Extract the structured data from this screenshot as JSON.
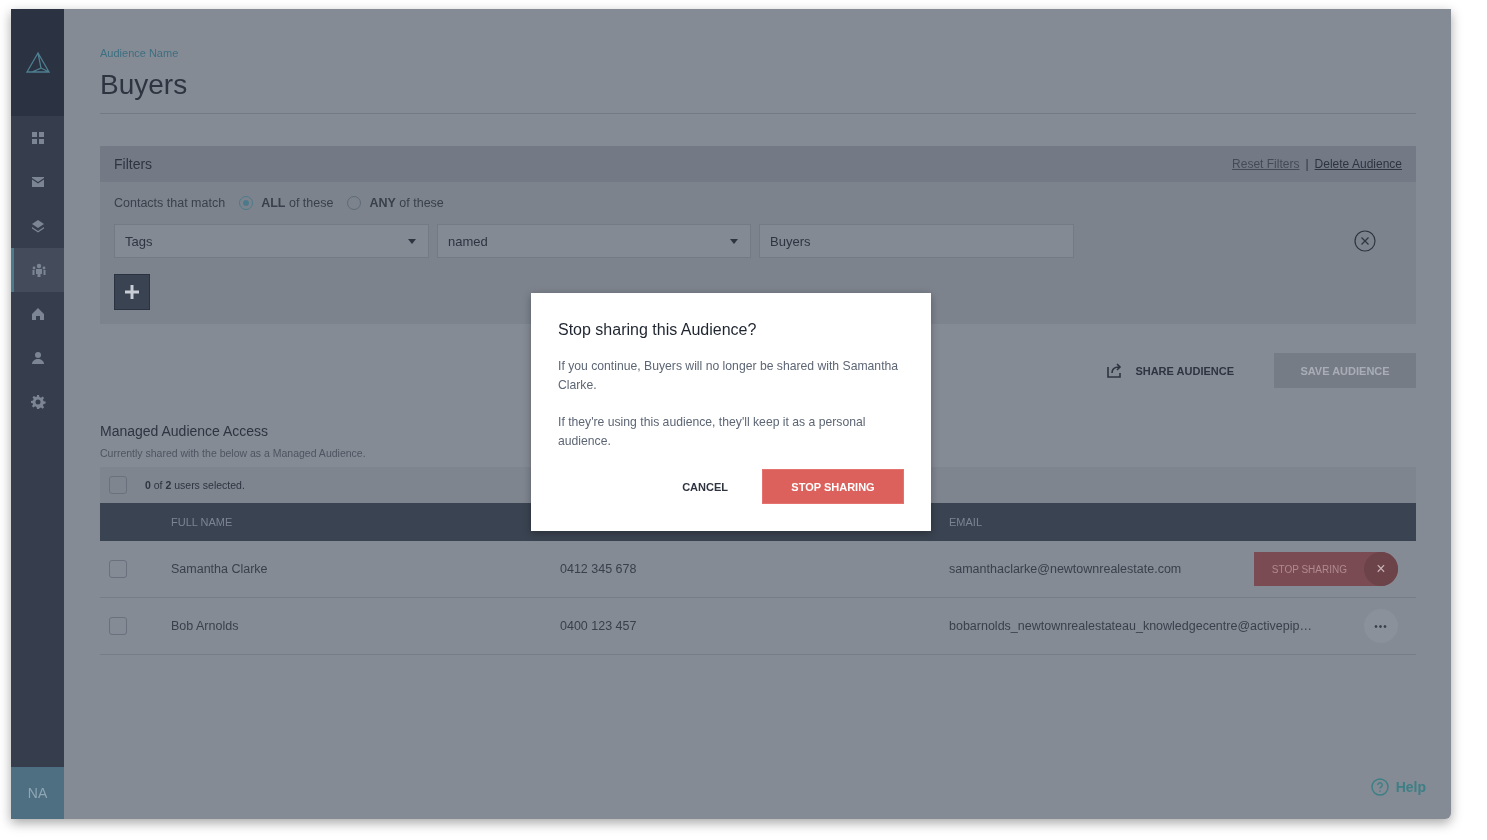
{
  "sidebar": {
    "items": [
      {
        "kind": "grid",
        "selected": false
      },
      {
        "kind": "mail",
        "selected": false
      },
      {
        "kind": "layers",
        "selected": false
      },
      {
        "kind": "people",
        "selected": true
      },
      {
        "kind": "home",
        "selected": false
      },
      {
        "kind": "person",
        "selected": false
      },
      {
        "kind": "gear",
        "selected": false
      }
    ],
    "avatar": "NA"
  },
  "header": {
    "label": "Audience Name",
    "title": "Buyers"
  },
  "filters": {
    "title": "Filters",
    "reset_link": "Reset Filters",
    "separator": "|",
    "delete_link": "Delete Audience",
    "match_label": "Contacts that match",
    "match_options": [
      {
        "label": "**ALL** of these",
        "selected": true
      },
      {
        "label": "**ANY** of these",
        "selected": false
      }
    ],
    "rule": {
      "field": "Tags",
      "operator": "named",
      "value": "Buyers"
    }
  },
  "actions": {
    "share": "SHARE AUDIENCE",
    "save": "SAVE AUDIENCE",
    "save_disabled": true
  },
  "access": {
    "title": "Managed Audience Access",
    "subtitle": "Currently shared with the below as a Managed Audience.",
    "select_all_checked": false,
    "summary": "**0** of **2** users selected.",
    "columns": {
      "full_name": "FULL NAME",
      "email": "EMAIL"
    },
    "rows": [
      {
        "name": "Samantha Clarke",
        "phone": "0412 345 678",
        "email": "samanthaclarke@newtownrealestate.com",
        "checked": false,
        "action": {
          "kind": "stop_sharing",
          "label": "STOP SHARING",
          "close": "×"
        }
      },
      {
        "name": "Bob Arnolds",
        "phone": "0400 123 457",
        "email": "bobarnolds_newtownrealestateau_knowledgecentre@activepip…",
        "checked": false,
        "action": {
          "kind": "menu",
          "label": "•••"
        }
      }
    ]
  },
  "dialog": {
    "title": "Stop sharing this Audience?",
    "paragraphs": [
      "If you continue, Buyers will no longer be shared with Samantha Clarke.",
      "If they're using this audience, they'll keep it as a personal audience."
    ],
    "cancel": "CANCEL",
    "confirm": "STOP SHARING"
  },
  "help": "Help"
}
